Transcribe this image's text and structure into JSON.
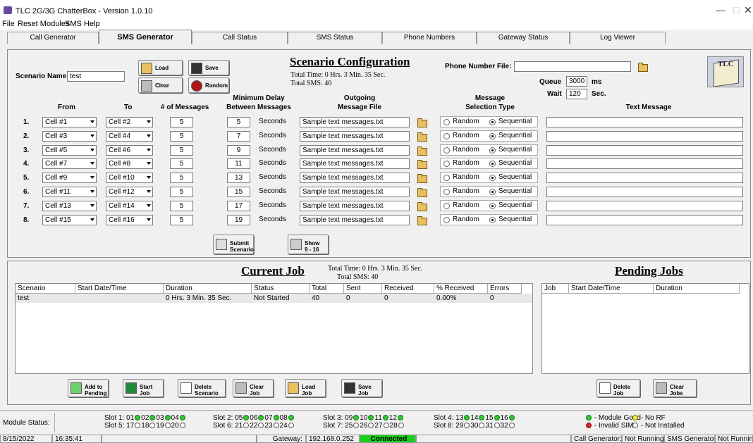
{
  "window": {
    "title": "TLC 2G/3G ChatterBox - Version 1.0.10",
    "minimize": "—",
    "maximize": "□",
    "close": "✕"
  },
  "menu": [
    "File",
    "Reset Modules",
    "SMS",
    "Help"
  ],
  "tabs": [
    "Call Generator",
    "SMS Generator",
    "Call Status",
    "SMS Status",
    "Phone Numbers",
    "Gateway Status",
    "Log Viewer"
  ],
  "scenario": {
    "name_label": "Scenario Name:",
    "name_value": "test",
    "load": "Load",
    "save": "Save",
    "clear": "Clear",
    "random": "Random",
    "title": "Scenario Configuration",
    "total_time": "Total Time: 0 Hrs. 3 Min. 35 Sec.",
    "total_sms": "Total SMS: 40",
    "phone_file_label": "Phone Number File:",
    "phone_file_value": "",
    "queue_label": "Queue",
    "queue_value": "3000",
    "queue_unit": "ms",
    "wait_label": "Wait",
    "wait_value": "120",
    "wait_unit": "Sec.",
    "headers": {
      "from": "From",
      "to": "To",
      "msgs": "# of Messages",
      "delay1": "Minimum Delay",
      "delay2": "Between Messages",
      "file1": "Outgoing",
      "file2": "Message File",
      "sel1": "Message",
      "sel2": "Selection Type",
      "text": "Text Message"
    },
    "seconds": "Seconds",
    "random_opt": "Random",
    "sequential_opt": "Sequential",
    "rows": [
      {
        "n": "1.",
        "from": "Cell #1",
        "to": "Cell #2",
        "msgs": "5",
        "delay": "5",
        "file": "Sample text messages.txt",
        "text": ""
      },
      {
        "n": "2.",
        "from": "Cell #3",
        "to": "Cell #4",
        "msgs": "5",
        "delay": "7",
        "file": "Sample text messages.txt",
        "text": ""
      },
      {
        "n": "3.",
        "from": "Cell #5",
        "to": "Cell #6",
        "msgs": "5",
        "delay": "9",
        "file": "Sample text messages.txt",
        "text": ""
      },
      {
        "n": "4.",
        "from": "Cell #7",
        "to": "Cell #8",
        "msgs": "5",
        "delay": "11",
        "file": "Sample text messages.txt",
        "text": ""
      },
      {
        "n": "5.",
        "from": "Cell #9",
        "to": "Cell #10",
        "msgs": "5",
        "delay": "13",
        "file": "Sample text messages.txt",
        "text": ""
      },
      {
        "n": "6.",
        "from": "Cell #11",
        "to": "Cell #12",
        "msgs": "5",
        "delay": "15",
        "file": "Sample text messages.txt",
        "text": ""
      },
      {
        "n": "7.",
        "from": "Cell #13",
        "to": "Cell #14",
        "msgs": "5",
        "delay": "17",
        "file": "Sample text messages.txt",
        "text": ""
      },
      {
        "n": "8.",
        "from": "Cell #15",
        "to": "Cell #16",
        "msgs": "5",
        "delay": "19",
        "file": "Sample text messages.txt",
        "text": ""
      }
    ],
    "submit1": "Submit",
    "submit2": "Scenario",
    "show1": "Show",
    "show2": "9 - 16"
  },
  "current_job": {
    "title": "Current Job",
    "total_time": "Total Time: 0 Hrs. 3 Min. 35 Sec.",
    "total_sms": "Total SMS: 40",
    "columns": [
      "Scenario",
      "Start Date/Time",
      "Duration",
      "Status",
      "Total",
      "Sent",
      "Received",
      "% Received",
      "Errors"
    ],
    "rows": [
      [
        "test",
        "",
        "0 Hrs. 3 Min. 35 Sec.",
        "Not Started",
        "40",
        "0",
        "0",
        "0.00%",
        "0"
      ]
    ],
    "buttons": [
      [
        "Add to",
        "Pending"
      ],
      [
        "Start",
        "Job"
      ],
      [
        "Delete",
        "Scenario"
      ],
      [
        "Clear",
        "Job"
      ],
      [
        "Load",
        "Job"
      ],
      [
        "Save",
        "Job"
      ]
    ]
  },
  "pending_jobs": {
    "title": "Pending Jobs",
    "columns": [
      "Job",
      "Start Date/Time",
      "Duration"
    ],
    "buttons": [
      [
        "Delete",
        "Job"
      ],
      [
        "Clear",
        "Jobs"
      ]
    ]
  },
  "module_status": {
    "label": "Module Status:",
    "slots": [
      [
        "Slot 1:",
        "01",
        "02",
        "03",
        "04"
      ],
      [
        "Slot 5:",
        "17",
        "18",
        "19",
        "20"
      ],
      [
        "Slot 2:",
        "05",
        "06",
        "07",
        "08"
      ],
      [
        "Slot 6:",
        "21",
        "22",
        "23",
        "24"
      ],
      [
        "Slot 3:",
        "09",
        "10",
        "11",
        "12"
      ],
      [
        "Slot 7:",
        "25",
        "26",
        "27",
        "28"
      ],
      [
        "Slot 4:",
        "13",
        "14",
        "15",
        "16"
      ],
      [
        "Slot 8:",
        "29",
        "30",
        "31",
        "32"
      ]
    ],
    "legend": {
      "good": "- Module Good",
      "norf": "- No RF",
      "invalid": "- Invalid SIM",
      "notinst": "- Not Installed"
    }
  },
  "statusbar": {
    "date": "8/15/2022",
    "time": "16:35:41",
    "gateway_label": "Gateway:",
    "gateway_ip": "192.168.0.252",
    "gateway_state": "Connected",
    "call_gen": "Call Generator:",
    "call_state": "Not Running",
    "sms_gen": "SMS Generator:",
    "sms_state": "Not Running"
  },
  "colors": {
    "connected": "#19d019",
    "good": "#2ec82e",
    "invalid": "#e02020"
  }
}
